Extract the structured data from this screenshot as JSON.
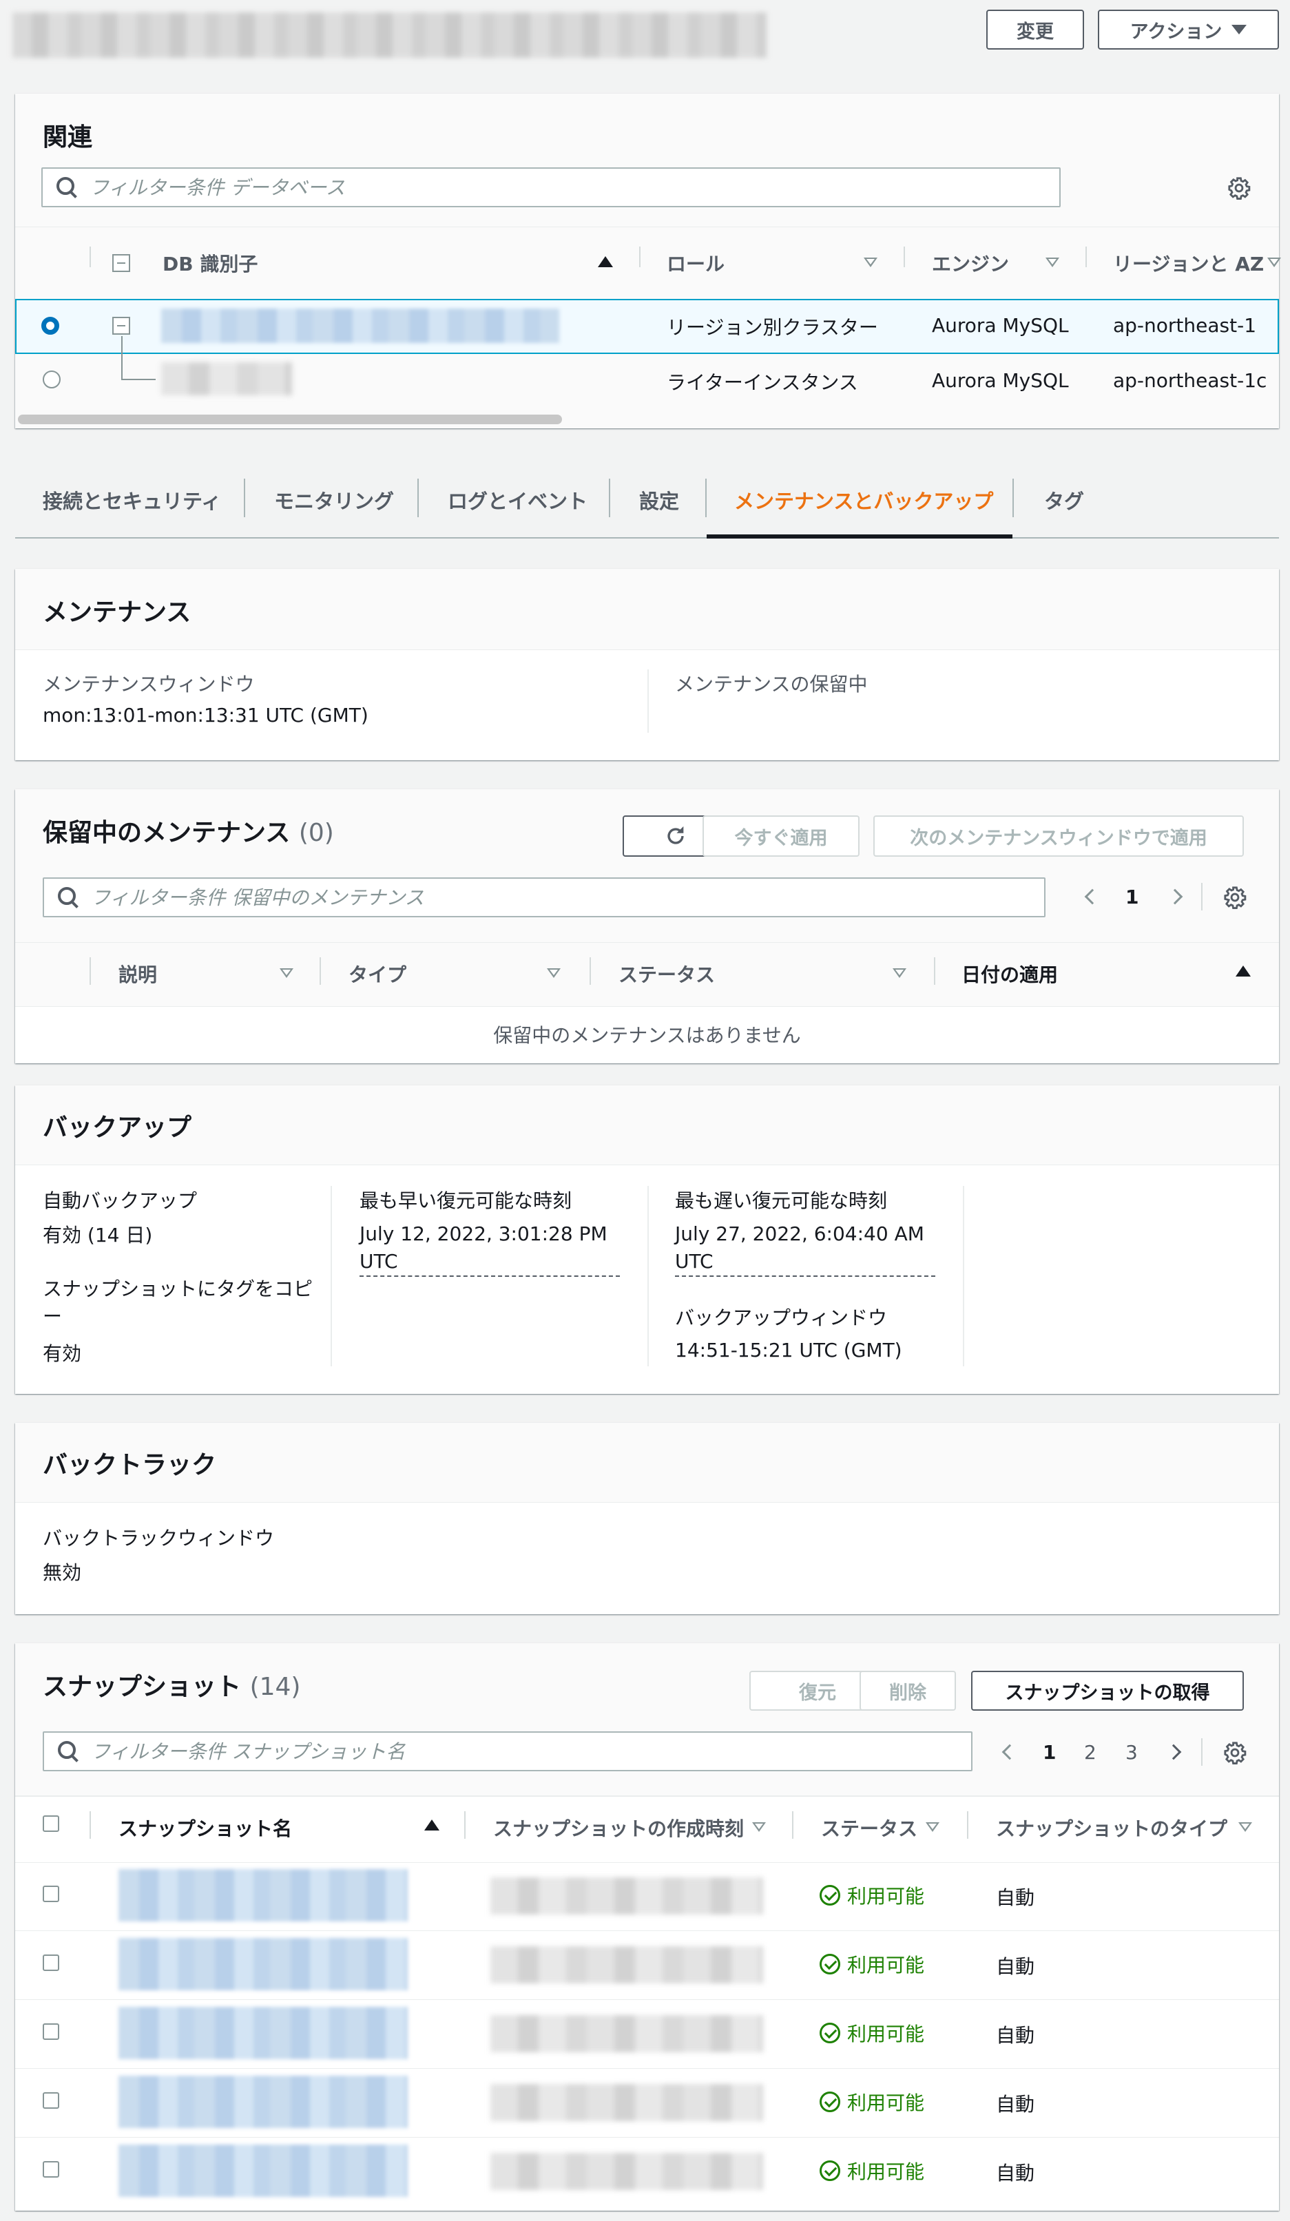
{
  "header": {
    "modify_button": "変更",
    "actions_button": "アクション"
  },
  "related": {
    "title": "関連",
    "search_placeholder": "フィルター条件 データベース",
    "columns": [
      "DB 識別子",
      "ロール",
      "エンジン",
      "リージョンと AZ"
    ],
    "rows": [
      {
        "role": "リージョン別クラスター",
        "engine": "Aurora MySQL",
        "region": "ap-northeast-1",
        "selected": true
      },
      {
        "role": "ライターインスタンス",
        "engine": "Aurora MySQL",
        "region": "ap-northeast-1c",
        "selected": false
      }
    ]
  },
  "tabs": [
    "接続とセキュリティ",
    "モニタリング",
    "ログとイベント",
    "設定",
    "メンテナンスとバックアップ",
    "タグ"
  ],
  "active_tab": "メンテナンスとバックアップ",
  "maintenance": {
    "title": "メンテナンス",
    "window_label": "メンテナンスウィンドウ",
    "window_value": "mon:13:01-mon:13:31 UTC (GMT)",
    "pending_label": "メンテナンスの保留中"
  },
  "pending": {
    "title": "保留中のメンテナンス",
    "count": "(0)",
    "apply_now": "今すぐ適用",
    "apply_next_window": "次のメンテナンスウィンドウで適用",
    "search_placeholder": "フィルター条件 保留中のメンテナンス",
    "page": "1",
    "columns": [
      "説明",
      "タイプ",
      "ステータス",
      "日付の適用"
    ],
    "empty": "保留中のメンテナンスはありません"
  },
  "backup": {
    "title": "バックアップ",
    "auto_label": "自動バックアップ",
    "auto_value": "有効 (14 日)",
    "copy_tags_label": "スナップショットにタグをコピー",
    "copy_tags_value": "有効",
    "earliest_label": "最も早い復元可能な時刻",
    "earliest_value": "July 12, 2022, 3:01:28 PM UTC",
    "latest_label": "最も遅い復元可能な時刻",
    "latest_value": "July 27, 2022, 6:04:40 AM UTC",
    "window_label": "バックアップウィンドウ",
    "window_value": "14:51-15:21 UTC (GMT)"
  },
  "backtrack": {
    "title": "バックトラック",
    "window_label": "バックトラックウィンドウ",
    "window_value": "無効"
  },
  "snapshots": {
    "title": "スナップショット",
    "count": "(14)",
    "restore": "復元",
    "delete": "削除",
    "take": "スナップショットの取得",
    "search_placeholder": "フィルター条件 スナップショット名",
    "pages": [
      "1",
      "2",
      "3"
    ],
    "columns": [
      "スナップショット名",
      "スナップショットの作成時刻",
      "ステータス",
      "スナップショットのタイプ"
    ],
    "rows": [
      {
        "status": "利用可能",
        "type": "自動"
      },
      {
        "status": "利用可能",
        "type": "自動"
      },
      {
        "status": "利用可能",
        "type": "自動"
      },
      {
        "status": "利用可能",
        "type": "自動"
      },
      {
        "status": "利用可能",
        "type": "自動"
      }
    ]
  },
  "colors": {
    "accent": "#ec7211",
    "selected_row_bg": "#f1faff",
    "selected_border": "#00a1c9",
    "radio_on": "#0073bb",
    "success": "#1d8102"
  }
}
